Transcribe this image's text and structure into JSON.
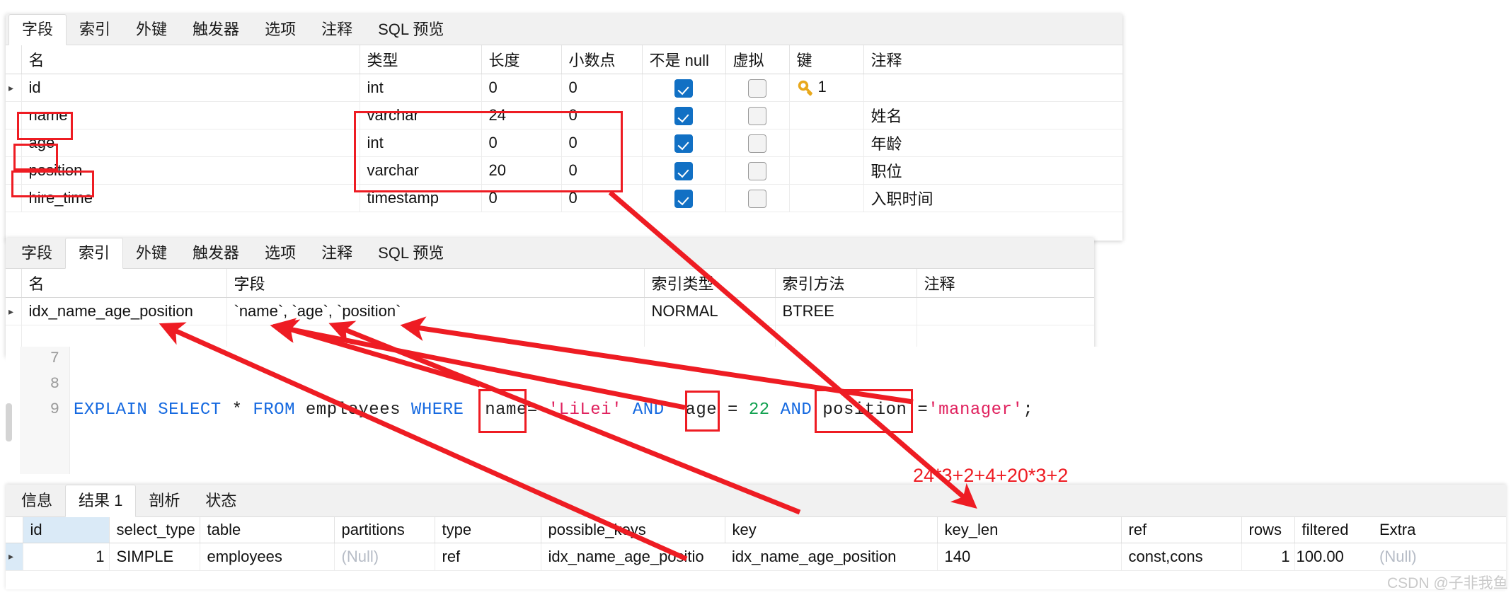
{
  "fields_panel": {
    "tabs": [
      {
        "label": "字段",
        "active": true
      },
      {
        "label": "索引",
        "active": false
      },
      {
        "label": "外键",
        "active": false
      },
      {
        "label": "触发器",
        "active": false
      },
      {
        "label": "选项",
        "active": false
      },
      {
        "label": "注释",
        "active": false
      },
      {
        "label": "SQL 预览",
        "active": false
      }
    ],
    "columns": [
      "名",
      "类型",
      "长度",
      "小数点",
      "不是 null",
      "虚拟",
      "键",
      "注释"
    ],
    "rows": [
      {
        "marker": "▸",
        "name": "id",
        "type": "int",
        "length": "0",
        "decimals": "0",
        "notnull": true,
        "virtual": false,
        "key": "1",
        "comment": ""
      },
      {
        "marker": "",
        "name": "name",
        "type": "varchar",
        "length": "24",
        "decimals": "0",
        "notnull": true,
        "virtual": false,
        "key": "",
        "comment": "姓名"
      },
      {
        "marker": "",
        "name": "age",
        "type": "int",
        "length": "0",
        "decimals": "0",
        "notnull": true,
        "virtual": false,
        "key": "",
        "comment": "年龄"
      },
      {
        "marker": "",
        "name": "position",
        "type": "varchar",
        "length": "20",
        "decimals": "0",
        "notnull": true,
        "virtual": false,
        "key": "",
        "comment": "职位"
      },
      {
        "marker": "",
        "name": "hire_time",
        "type": "timestamp",
        "length": "0",
        "decimals": "0",
        "notnull": true,
        "virtual": false,
        "key": "",
        "comment": "入职时间"
      }
    ]
  },
  "index_panel": {
    "tabs": [
      {
        "label": "字段",
        "active": false
      },
      {
        "label": "索引",
        "active": true
      },
      {
        "label": "外键",
        "active": false
      },
      {
        "label": "触发器",
        "active": false
      },
      {
        "label": "选项",
        "active": false
      },
      {
        "label": "注释",
        "active": false
      },
      {
        "label": "SQL 预览",
        "active": false
      }
    ],
    "columns": [
      "名",
      "字段",
      "索引类型",
      "索引方法",
      "注释"
    ],
    "rows": [
      {
        "marker": "▸",
        "name": "idx_name_age_position",
        "fields": "`name`, `age`, `position`",
        "index_type": "NORMAL",
        "index_method": "BTREE",
        "comment": ""
      }
    ]
  },
  "editor": {
    "line_numbers": [
      "7",
      "8",
      "9"
    ],
    "sql_tokens": [
      {
        "t": "EXPLAIN",
        "c": "kw"
      },
      {
        "t": " ",
        "c": "id"
      },
      {
        "t": "SELECT",
        "c": "kw"
      },
      {
        "t": " ",
        "c": "id"
      },
      {
        "t": "*",
        "c": "id"
      },
      {
        "t": " ",
        "c": "id"
      },
      {
        "t": "FROM",
        "c": "kw"
      },
      {
        "t": " employees ",
        "c": "id"
      },
      {
        "t": "WHERE",
        "c": "kw"
      },
      {
        "t": "  name",
        "c": "id"
      },
      {
        "t": "= ",
        "c": "id"
      },
      {
        "t": "'LiLei'",
        "c": "str"
      },
      {
        "t": " ",
        "c": "id"
      },
      {
        "t": "AND",
        "c": "kw"
      },
      {
        "t": "  age ",
        "c": "id"
      },
      {
        "t": "= ",
        "c": "id"
      },
      {
        "t": "22",
        "c": "num"
      },
      {
        "t": " ",
        "c": "id"
      },
      {
        "t": "AND",
        "c": "kw"
      },
      {
        "t": " position ",
        "c": "id"
      },
      {
        "t": "=",
        "c": "id"
      },
      {
        "t": "'manager'",
        "c": "str"
      },
      {
        "t": ";",
        "c": "id"
      }
    ],
    "sql_plain": "EXPLAIN SELECT * FROM employees WHERE  name= 'LiLei' AND  age = 22 AND position ='manager';"
  },
  "results_panel": {
    "tabs": [
      {
        "label": "信息",
        "active": false
      },
      {
        "label": "结果 1",
        "active": true
      },
      {
        "label": "剖析",
        "active": false
      },
      {
        "label": "状态",
        "active": false
      }
    ],
    "columns": [
      "id",
      "select_type",
      "table",
      "partitions",
      "type",
      "possible_keys",
      "key",
      "key_len",
      "ref",
      "rows",
      "filtered",
      "Extra"
    ],
    "rows": [
      {
        "marker": "▸",
        "id": "1",
        "select_type": "SIMPLE",
        "table": "employees",
        "partitions": "(Null)",
        "type": "ref",
        "possible_keys": "idx_name_age_positio",
        "key": "idx_name_age_position",
        "key_len": "140",
        "ref": "const,cons",
        "rows": "1",
        "filtered": "100.00",
        "extra": "(Null)"
      }
    ]
  },
  "annotations": {
    "key_len_formula": "24*3+2+4+20*3+2",
    "accent_color": "#ee1c23",
    "watermark": "CSDN @子非我鱼"
  }
}
